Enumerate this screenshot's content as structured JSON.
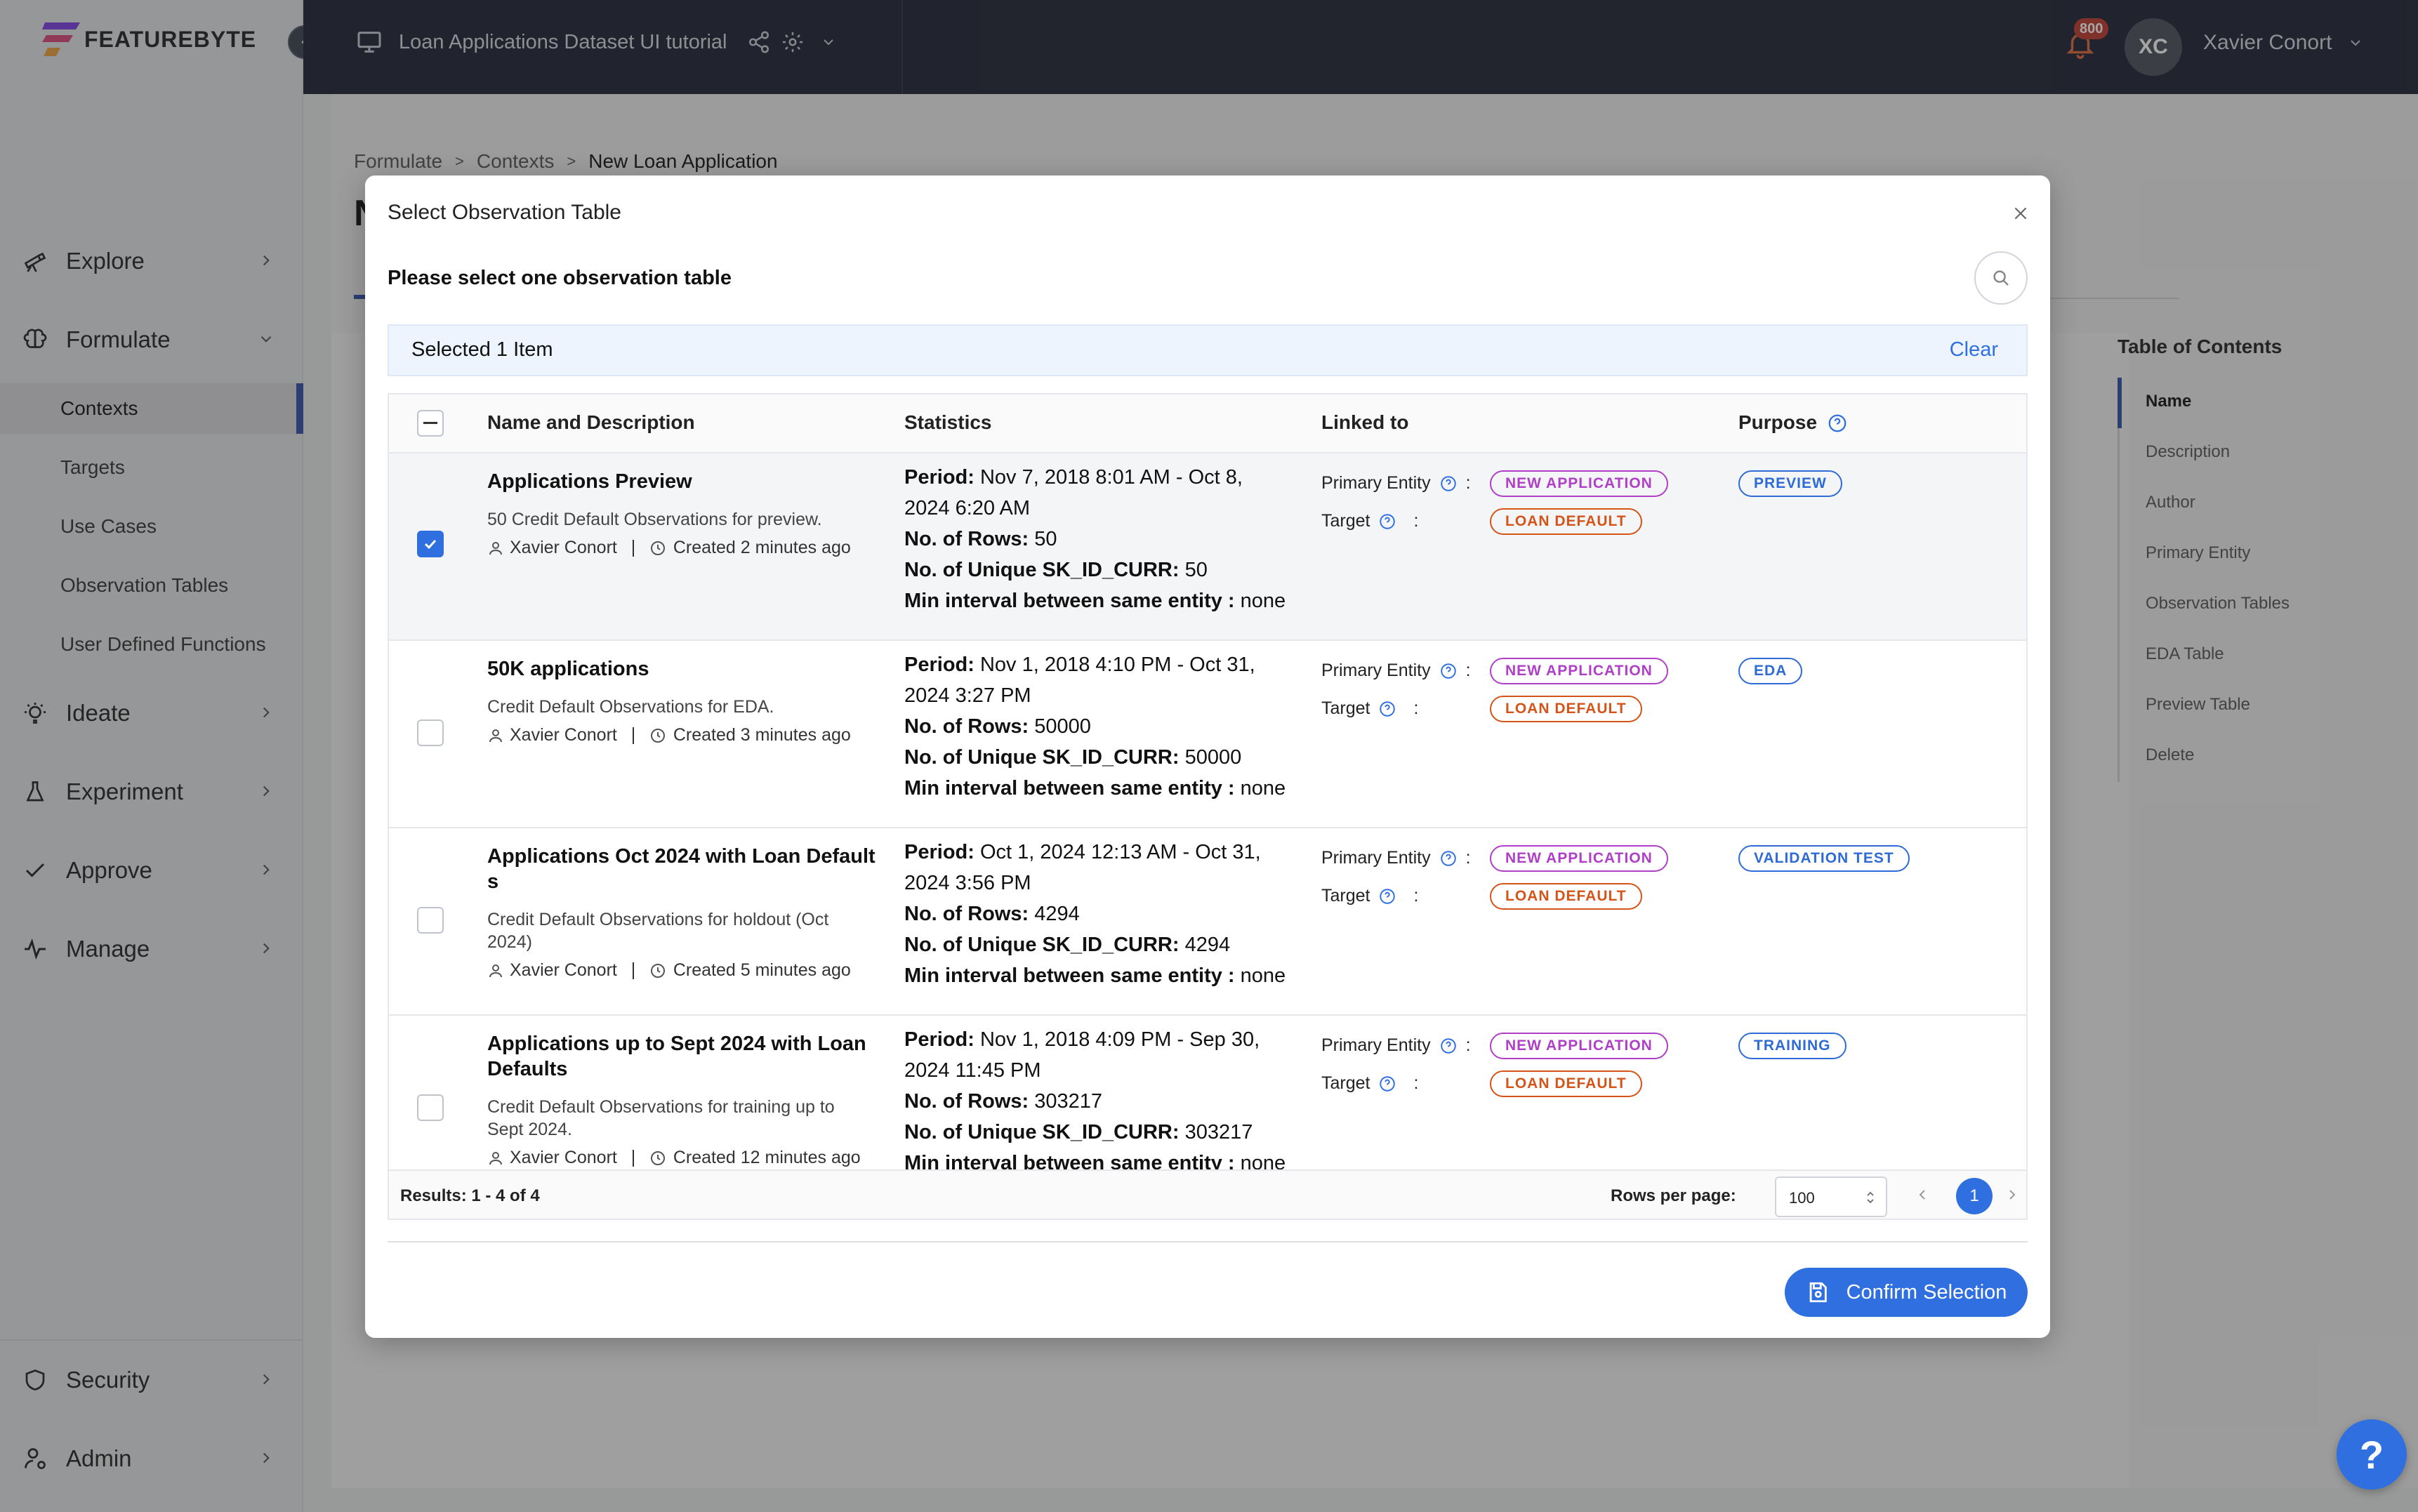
{
  "app": {
    "logo_text": "FEATUREBYTE"
  },
  "topbar": {
    "catalog_name": "Loan Applications Dataset UI tutorial",
    "notification_count": "800",
    "user_initials": "XC",
    "user_name": "Xavier Conort"
  },
  "sidebar": {
    "items": [
      {
        "label": "Explore",
        "icon": "telescope-icon"
      },
      {
        "label": "Formulate",
        "icon": "brain-icon"
      },
      {
        "label": "Ideate",
        "icon": "lightbulb-icon"
      },
      {
        "label": "Experiment",
        "icon": "flask-icon"
      },
      {
        "label": "Approve",
        "icon": "check-icon"
      },
      {
        "label": "Manage",
        "icon": "pulse-icon"
      },
      {
        "label": "Security",
        "icon": "shield-icon"
      },
      {
        "label": "Admin",
        "icon": "user-gear-icon"
      }
    ],
    "formulate_subitems": [
      "Contexts",
      "Targets",
      "Use Cases",
      "Observation Tables",
      "User Defined Functions"
    ],
    "active_subitem": "Contexts"
  },
  "breadcrumb": [
    "Formulate",
    "Contexts",
    "New Loan Application"
  ],
  "breadcrumb_sep": ">",
  "page_title_initial": "N",
  "toc": {
    "title": "Table of Contents",
    "items": [
      "Name",
      "Description",
      "Author",
      "Primary Entity",
      "Observation Tables",
      "EDA Table",
      "Preview Table",
      "Delete"
    ],
    "active": "Name"
  },
  "modal": {
    "title": "Select Observation Table",
    "subtitle": "Please select one observation table",
    "selection_text": "Selected 1 Item",
    "clear_label": "Clear",
    "columns": [
      "Name and Description",
      "Statistics",
      "Linked to",
      "Purpose"
    ],
    "linked_labels": {
      "primary_entity": "Primary Entity",
      "target": "Target",
      "separator": ":"
    },
    "rows": [
      {
        "name": "Applications Preview",
        "description": "50 Credit Default Observations for preview.",
        "author": "Xavier Conort",
        "created": "Created 2 minutes ago",
        "selected": true,
        "period_label": "Period:",
        "period_line1": "Nov 7, 2018 8:01 AM - Oct 8,",
        "period_line2": "2024 6:20 AM",
        "rows_label": "No. of Rows:",
        "rows_value": "50",
        "unique_label": "No. of Unique SK_ID_CURR:",
        "unique_value": "50",
        "interval_label": "Min interval between same entity :",
        "interval_value": "none",
        "primary_entity": "NEW APPLICATION",
        "target": "LOAN DEFAULT",
        "purpose": "PREVIEW"
      },
      {
        "name": "50K applications",
        "description": "Credit Default Observations for EDA.",
        "author": "Xavier Conort",
        "created": "Created 3 minutes ago",
        "selected": false,
        "period_label": "Period:",
        "period_line1": "Nov 1, 2018 4:10 PM - Oct 31,",
        "period_line2": "2024 3:27 PM",
        "rows_label": "No. of Rows:",
        "rows_value": "50000",
        "unique_label": "No. of Unique SK_ID_CURR:",
        "unique_value": "50000",
        "interval_label": "Min interval between same entity :",
        "interval_value": "none",
        "primary_entity": "NEW APPLICATION",
        "target": "LOAN DEFAULT",
        "purpose": "EDA"
      },
      {
        "name_line1": "Applications Oct 2024 with Loan Default",
        "name_line2": "s",
        "description_line1": "Credit Default Observations for holdout (Oct",
        "description_line2": "2024)",
        "author": "Xavier Conort",
        "created": "Created 5 minutes ago",
        "selected": false,
        "period_label": "Period:",
        "period_line1": "Oct 1, 2024 12:13 AM - Oct 31,",
        "period_line2": "2024 3:56 PM",
        "rows_label": "No. of Rows:",
        "rows_value": "4294",
        "unique_label": "No. of Unique SK_ID_CURR:",
        "unique_value": "4294",
        "interval_label": "Min interval between same entity :",
        "interval_value": "none",
        "primary_entity": "NEW APPLICATION",
        "target": "LOAN DEFAULT",
        "purpose": "VALIDATION TEST"
      },
      {
        "name_line1": "Applications up to Sept 2024 with Loan",
        "name_line2": "Defaults",
        "description_line1": "Credit Default Observations for training up to",
        "description_line2": "Sept 2024.",
        "author": "Xavier Conort",
        "created": "Created 12 minutes ago",
        "selected": false,
        "period_label": "Period:",
        "period_line1": "Nov 1, 2018 4:09 PM - Sep 30,",
        "period_line2": "2024 11:45 PM",
        "rows_label": "No. of Rows:",
        "rows_value": "303217",
        "unique_label": "No. of Unique SK_ID_CURR:",
        "unique_value": "303217",
        "interval_label": "Min interval between same entity :",
        "interval_value": "none",
        "primary_entity": "NEW APPLICATION",
        "target": "LOAN DEFAULT",
        "purpose": "TRAINING"
      }
    ],
    "results_text": "Results: 1 - 4 of 4",
    "rows_per_page_label": "Rows per page:",
    "rows_per_page_value": "100",
    "current_page": "1",
    "confirm_label": "Confirm Selection"
  },
  "help_button": "?",
  "colors": {
    "primary": "#2f6fe0",
    "topbar": "#1d2233",
    "app_tag": "#b03fc7",
    "target_tag": "#d4541a"
  }
}
